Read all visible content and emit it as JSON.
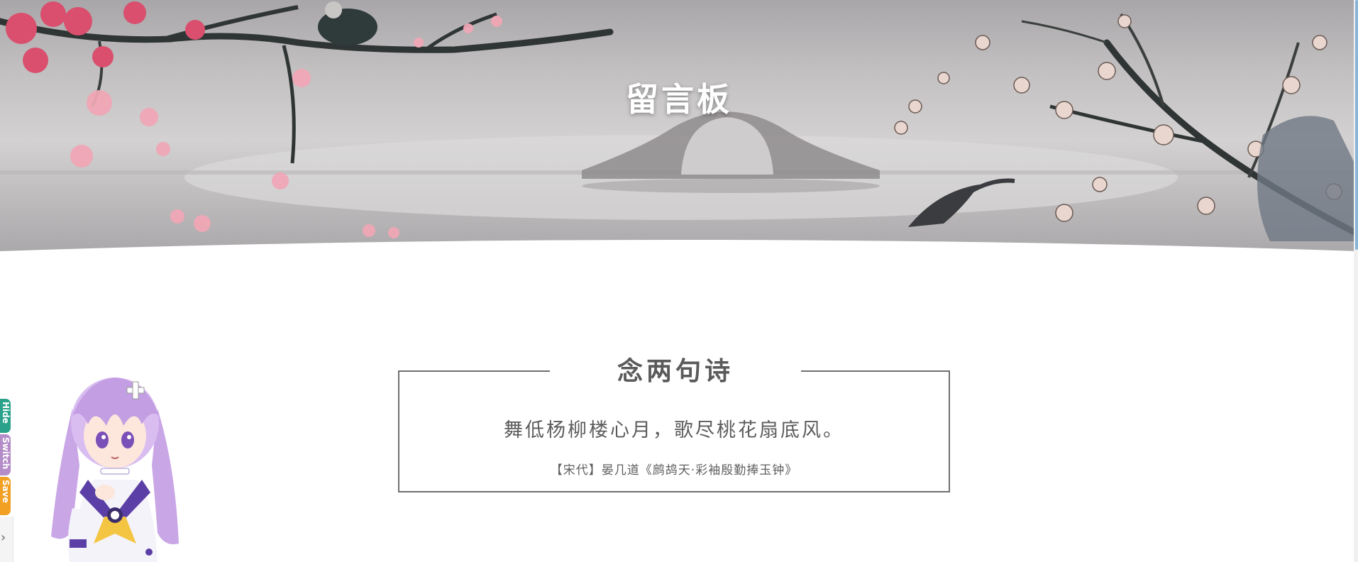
{
  "hero": {
    "title": "留言板"
  },
  "poem": {
    "heading": "念两句诗",
    "line": "舞低杨柳楼心月，歌尽桃花扇底风。",
    "source": "【宋代】晏几道《鹧鸪天·彩袖殷勤捧玉钟》"
  },
  "widget": {
    "hide_label": "Hide",
    "switch_label": "Switch",
    "save_label": "Save",
    "toggle_glyph": "›"
  },
  "colors": {
    "hide": "#2aa18a",
    "switch": "#b48cc8",
    "save": "#f2a024",
    "card_border": "#6f6f6f",
    "text": "#5a5a5a"
  }
}
